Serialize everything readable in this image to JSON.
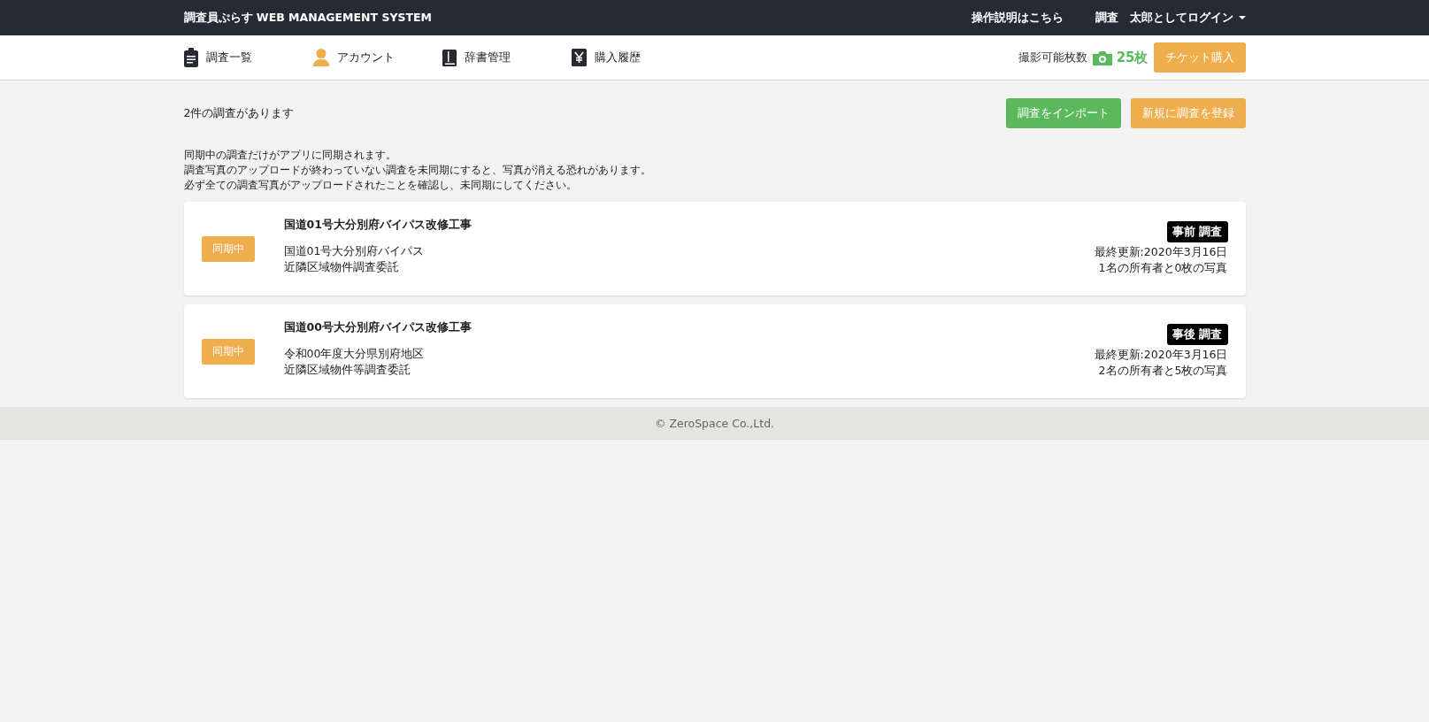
{
  "topbar": {
    "brand": "調査員ぷらす WEB MANAGEMENT SYSTEM",
    "help_link": "操作説明はこちら",
    "user_menu": "調査　太郎としてログイン"
  },
  "nav": {
    "items": [
      {
        "label": "調査一覧",
        "kind": "clipboard"
      },
      {
        "label": "アカウント",
        "kind": "person"
      },
      {
        "label": "辞書管理",
        "kind": "book"
      },
      {
        "label": "購入履歴",
        "kind": "yen"
      }
    ],
    "shots_label": "撮影可能枚数",
    "shots_count": "25枚",
    "buy_button": "チケット購入"
  },
  "summary": "2件の調査があります",
  "buttons": [
    {
      "label": "調査をインポート",
      "kind": "import"
    },
    {
      "label": "新規に調査を登録",
      "kind": "new"
    }
  ],
  "notice": [
    "同期中の調査だけがアプリに同期されます。",
    "調査写真のアップロードが終わっていない調査を未同期にすると、写真が消える恐れがあります。",
    "必ず全ての調査写真がアップロードされたことを確認し、未同期にしてください。"
  ],
  "surveys": [
    {
      "status": "同期中",
      "title": "国道01号大分別府バイパス改修工事",
      "lines": [
        "国道01号大分別府バイパス",
        "近隣区域物件調査委託"
      ],
      "tag": "事前 調査",
      "updated": "最終更新:2020年3月16日",
      "counts": "1名の所有者と0枚の写真"
    },
    {
      "status": "同期中",
      "title": "国道00号大分別府バイパス改修工事",
      "lines": [
        "令和00年度大分県別府地区",
        "近隣区域物件等調査委託"
      ],
      "tag": "事後 調査",
      "updated": "最終更新:2020年3月16日",
      "counts": "2名の所有者と5枚の写真"
    }
  ],
  "footer": "© ZeroSpace Co.,Ltd."
}
